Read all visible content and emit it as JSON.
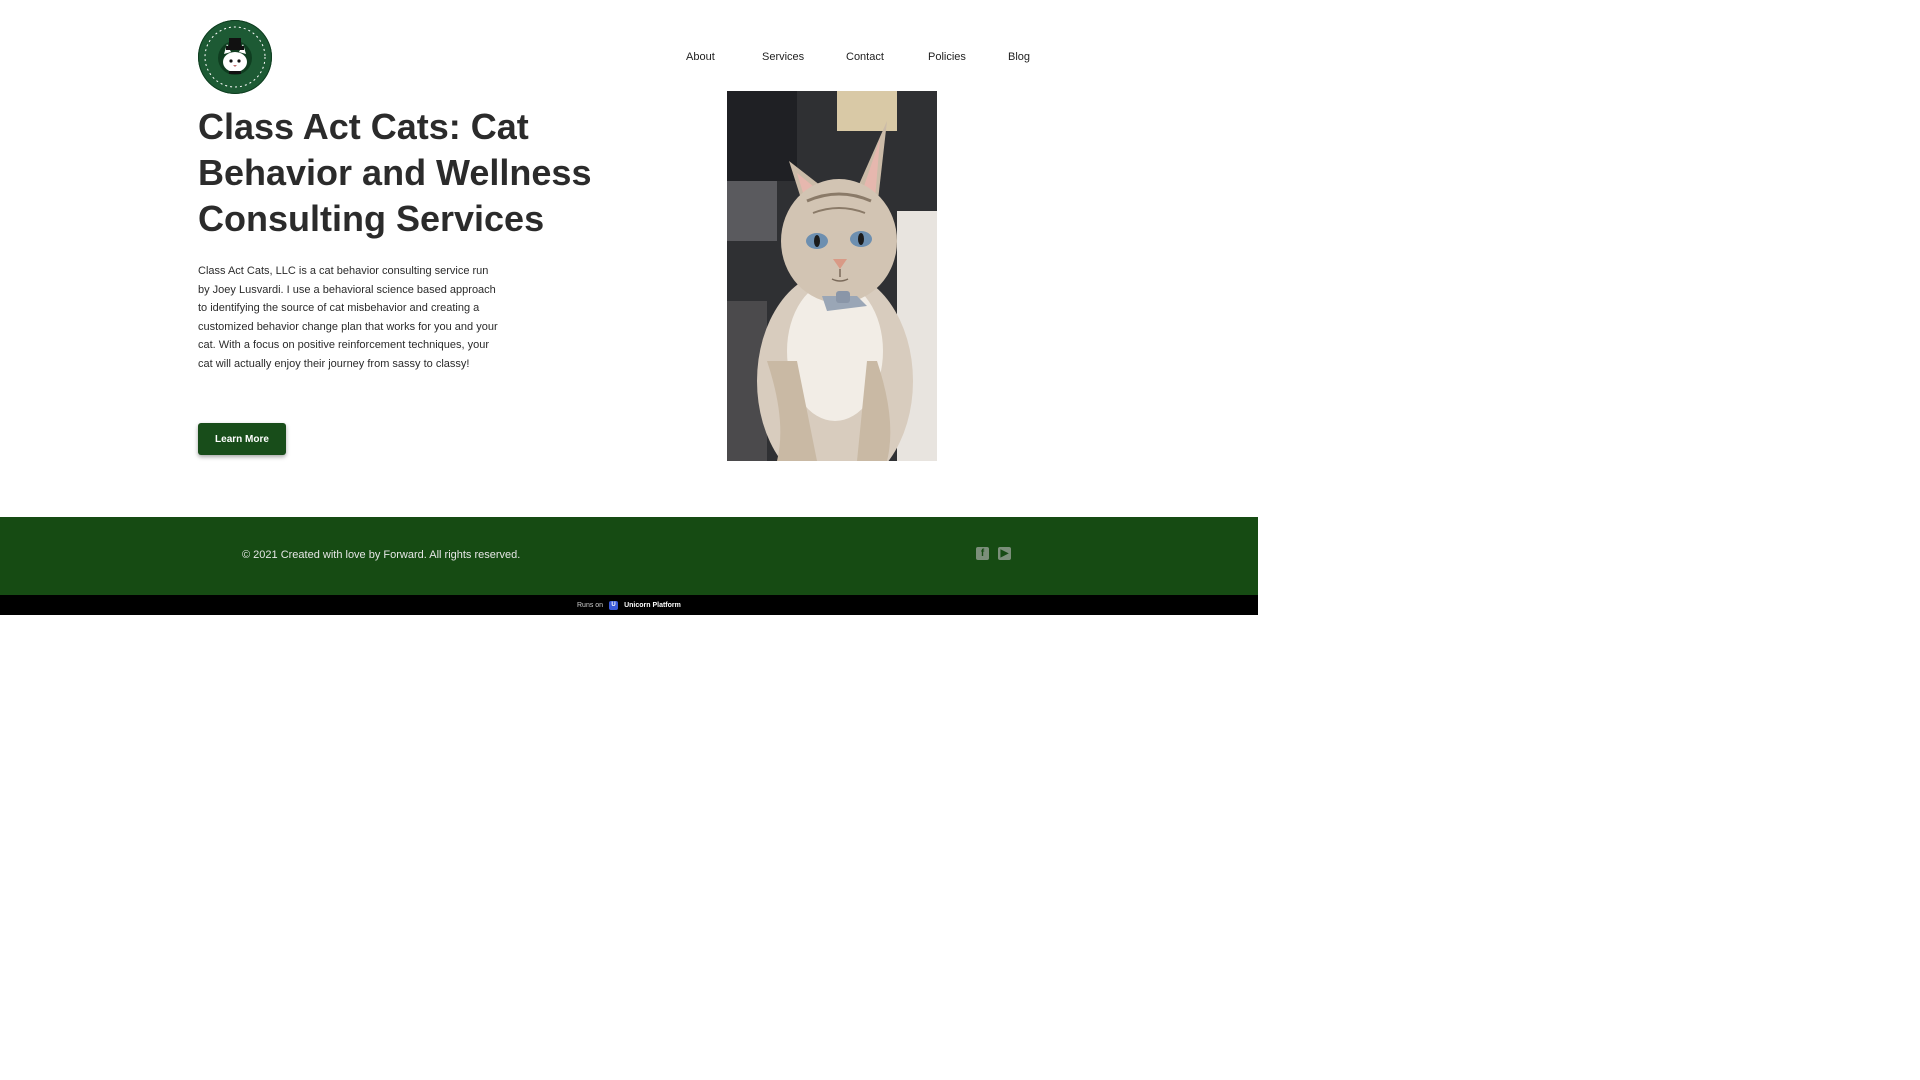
{
  "header": {
    "logo_name": "Class Act Cats logo",
    "nav": [
      {
        "label": "About"
      },
      {
        "label": "Services"
      },
      {
        "label": "Contact"
      },
      {
        "label": "Policies"
      },
      {
        "label": "Blog"
      }
    ]
  },
  "hero": {
    "title": "Class Act Cats: Cat Behavior and Wellness Consulting Services",
    "description": "Class Act Cats, LLC is a cat behavior consulting service run by Joey Lusvardi. I use a behavioral science based approach to identifying the source of cat misbehavior and creating a customized behavior change plan that works for you and your cat. With a focus on positive reinforcement techniques, your cat will actually enjoy their journey from sassy to classy!",
    "button_label": "Learn More",
    "image": "cat-photo"
  },
  "footer": {
    "copyright": "© 2021 Created with love by Forward. All rights reserved.",
    "social_icons": [
      "facebook-icon",
      "youtube-icon"
    ]
  },
  "runs_on": {
    "prefix": "Runs on",
    "platform": "Unicorn Platform"
  },
  "colors": {
    "brand_green": "#164b13",
    "button_green": "#184d1a",
    "text_dark": "#2b2b2b"
  }
}
